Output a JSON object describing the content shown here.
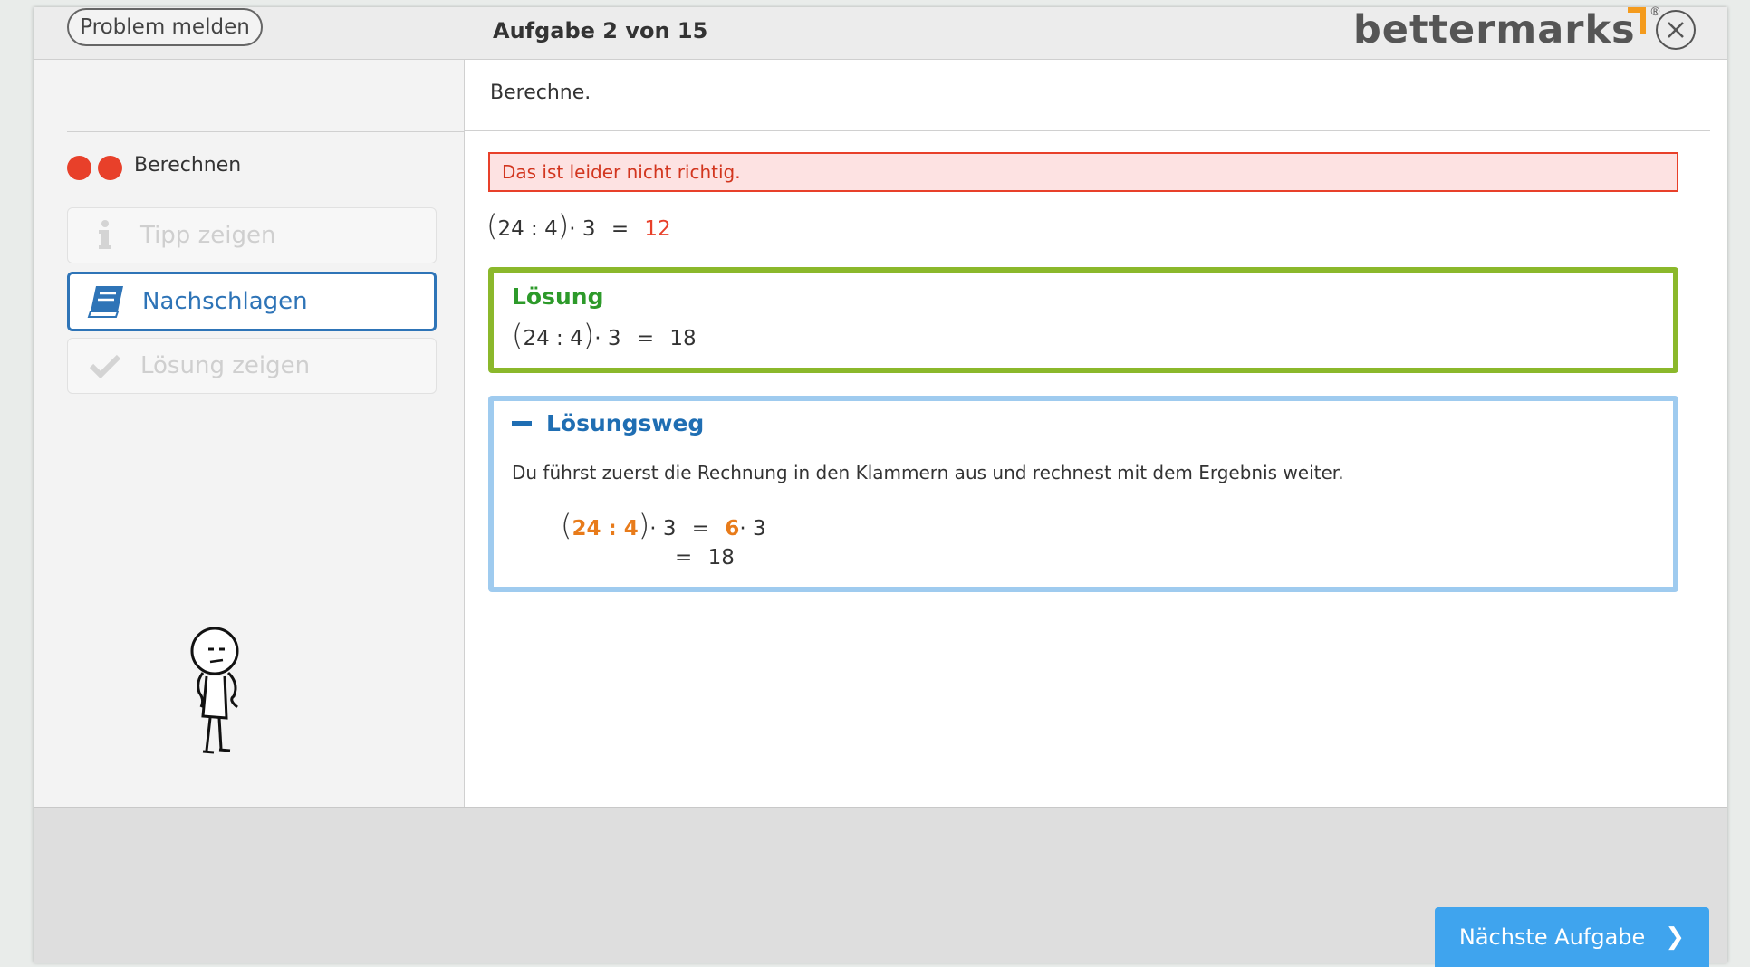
{
  "header": {
    "report_button": "Problem melden",
    "task_title": "Aufgabe 2 von 15",
    "brand": "bettermarks",
    "brand_mark": "®",
    "close_icon": "close-icon"
  },
  "sidebar": {
    "status_dots": [
      "red",
      "red"
    ],
    "topic_label": "Berechnen",
    "buttons": {
      "tip": "Tipp zeigen",
      "lookup": "Nachschlagen",
      "solution": "Lösung zeigen"
    }
  },
  "main": {
    "prompt": "Berechne.",
    "error_message": "Das ist leider nicht richtig.",
    "answer": {
      "left": "(24 : 4) · 3 =",
      "expr_inner": "24 : 4",
      "factor": "· 3",
      "eq": "=",
      "user_value": "12"
    },
    "solution": {
      "title": "Lösung",
      "expr_inner": "24 : 4",
      "factor": "· 3",
      "eq": "=",
      "value": "18"
    },
    "steps": {
      "title": "Lösungsweg",
      "explanation": "Du führst zuerst die Rechnung in den Klammern aus und rechnest mit dem Ergebnis weiter.",
      "step1_inner": "24 : 4",
      "step1_factor": "· 3",
      "step1_eq": "=",
      "step1_result_hl": "6",
      "step1_rest": "· 3",
      "step2_eq": "=",
      "step2_value": "18"
    }
  },
  "footer": {
    "next_button": "Nächste Aufgabe"
  },
  "colors": {
    "accent_blue": "#2e74b7",
    "next_button": "#3fa4ee",
    "error_red": "#e8402a",
    "solution_green": "#8bb82b",
    "steps_blue": "#9fcbef",
    "highlight_orange": "#e87b1a",
    "brand_orange": "#f49b1d"
  }
}
